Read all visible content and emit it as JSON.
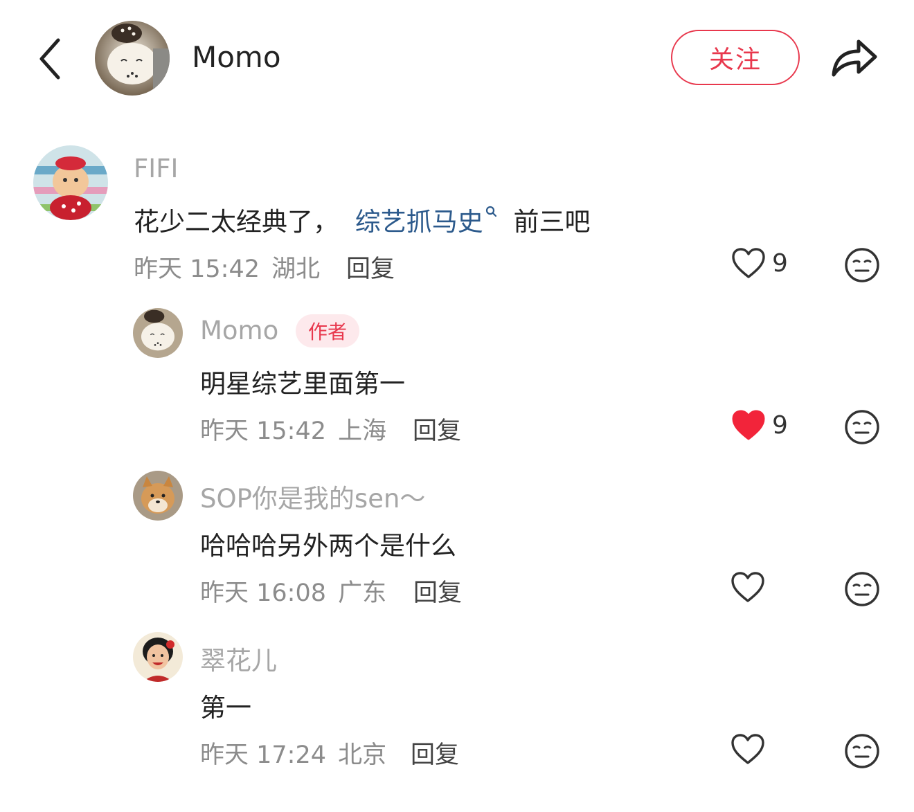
{
  "header": {
    "title": "Momo",
    "follow_label": "关注",
    "icons": {
      "back": "chevron-left-icon",
      "share": "share-arrow-icon"
    }
  },
  "colors": {
    "accent": "#e8384d",
    "topic_link": "#2c5a8c",
    "muted_text": "#8c8c8c",
    "username_text": "#a6a6a6",
    "badge_bg": "#fde9ec"
  },
  "comments": [
    {
      "user": "FIFI",
      "text_before": "花少二太经典了，",
      "topic": "综艺抓马史",
      "text_after": "前三吧",
      "time": "昨天 15:42",
      "location": "湖北",
      "reply_label": "回复",
      "likes": "9",
      "liked": false
    },
    {
      "user": "Momo",
      "badge": "作者",
      "text": "明星综艺里面第一",
      "time": "昨天 15:42",
      "location": "上海",
      "reply_label": "回复",
      "likes": "9",
      "liked": true
    },
    {
      "user": "SOP你是我的sen～",
      "text": "哈哈哈另外两个是什么",
      "time": "昨天 16:08",
      "location": "广东",
      "reply_label": "回复",
      "liked": false
    },
    {
      "user": "翠花儿",
      "text": "第一",
      "time": "昨天 17:24",
      "location": "北京",
      "reply_label": "回复",
      "liked": false
    }
  ]
}
